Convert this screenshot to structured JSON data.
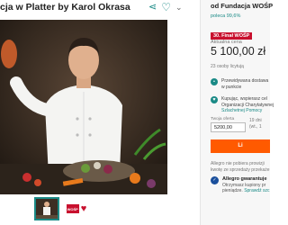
{
  "header": {
    "title": "cja w Platter by Karol Okrasa",
    "icons": [
      "share-icon",
      "heart-icon",
      "chevron-down-icon"
    ]
  },
  "gallery": {
    "thumb_logo_text": "WOŚP"
  },
  "seller": {
    "name": "od Fundacja WOŚP",
    "recommend": "poleca 99,6%"
  },
  "offer": {
    "badge": "30. Finał WOŚP",
    "badge_sub": "Aktualna cena",
    "price": "5 100,00 zł",
    "bidders": "23 osoby licytują"
  },
  "delivery": {
    "text_line1": "Przewidywana dostawa",
    "text_line2": "w punkcie"
  },
  "charity": {
    "line1": "Kupując, wspierasz cel",
    "line2": "Organizacji Charytatywnej",
    "link": "Szlachetnej Pomocy"
  },
  "bid": {
    "label": "Twoja oferta",
    "value": "5200,00",
    "date_line1": "19 dni",
    "date_line2": "(wt., 1",
    "button": "Li"
  },
  "note": {
    "line1": "Allegro nie pobiera prowizji",
    "line2": "kwotę ze sprzedaży przekaże"
  },
  "smart": {
    "title": "Allegro gwarantuje",
    "line1": "Otrzymasz kupiony pr",
    "line2": "pieniądze.",
    "link": "Sprawdź szc"
  },
  "colors": {
    "accent": "#1a8a86",
    "cta": "#ff5a00",
    "wosp_red": "#c8102e"
  }
}
